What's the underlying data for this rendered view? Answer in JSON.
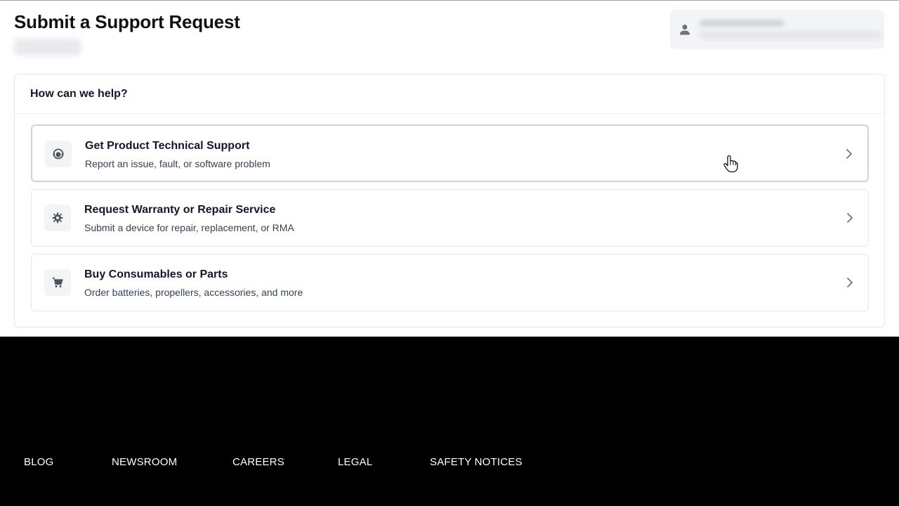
{
  "page": {
    "title": "Submit a Support Request"
  },
  "user": {
    "icon": "user-icon"
  },
  "help": {
    "heading": "How can we help?",
    "options": [
      {
        "title": "Get Product Technical Support",
        "description": "Report an issue, fault, or software problem",
        "icon": "support-agent-icon"
      },
      {
        "title": "Request Warranty or Repair Service",
        "description": "Submit a device for repair, replacement, or RMA",
        "icon": "gear-icon"
      },
      {
        "title": "Buy Consumables or Parts",
        "description": "Order batteries, propellers, accessories, and more",
        "icon": "cart-icon"
      }
    ]
  },
  "footer": {
    "links": [
      "BLOG",
      "NEWSROOM",
      "CAREERS",
      "LEGAL",
      "SAFETY NOTICES"
    ]
  },
  "colors": {
    "footer_bg": "#000000",
    "panel_border": "#e5e7eb",
    "icon_bg": "#f3f4f6"
  }
}
